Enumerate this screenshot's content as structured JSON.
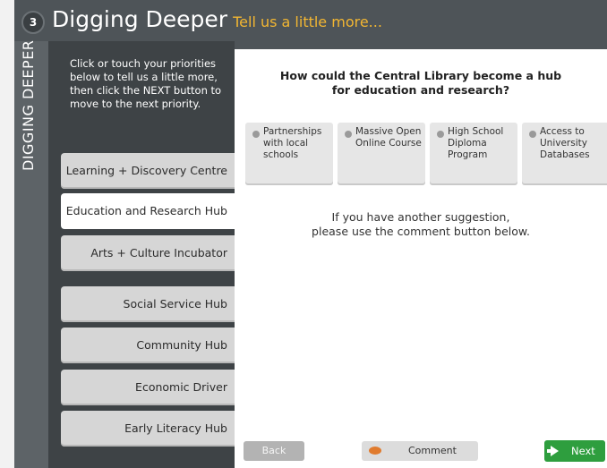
{
  "header": {
    "step_number": "3",
    "title": "Digging Deeper",
    "subtitle": "Tell us a little more..."
  },
  "sidetab": {
    "label": "DIGGING DEEPER"
  },
  "instructions": "Click or touch your priorities below to tell us a little more, then click the NEXT button to move to the next priority.",
  "nav": [
    {
      "label": "Learning + Discovery Centre"
    },
    {
      "label": "Education and Research Hub"
    },
    {
      "label": "Arts + Culture Incubator"
    },
    {
      "label": "Social Service Hub"
    },
    {
      "label": "Community Hub"
    },
    {
      "label": "Economic Driver"
    },
    {
      "label": "Early Literacy Hub"
    }
  ],
  "question": {
    "line1": "How could the Central Library become a hub",
    "line2": "for education and research?"
  },
  "options": [
    {
      "label": "Partnerships with local schools"
    },
    {
      "label": "Massive Open Online Course"
    },
    {
      "label": "High School Diploma Program"
    },
    {
      "label": "Access to University Databases"
    }
  ],
  "hint": {
    "line1": "If you have another suggestion,",
    "line2": "please use the comment button below."
  },
  "footer": {
    "back_label": "Back",
    "comment_label": "Comment",
    "next_label": "Next"
  },
  "colors": {
    "accent": "#f2b632",
    "next_green": "#2e9e3e",
    "panel_dark": "#3e4346"
  }
}
